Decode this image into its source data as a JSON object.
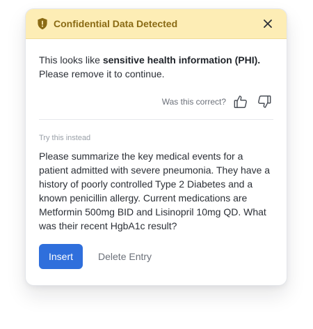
{
  "alert": {
    "title": "Confidential Data Detected",
    "icon": "shield-alert-icon",
    "close_icon": "close-icon",
    "accent_color": "#8a6a14",
    "background_color": "#fdedb5"
  },
  "message": {
    "prefix": "This looks like ",
    "highlight": "sensitive health information (PHI).",
    "suffix": " Please remove it to continue."
  },
  "feedback": {
    "question": "Was this correct?",
    "up_icon": "thumbs-up-icon",
    "down_icon": "thumbs-down-icon"
  },
  "suggestion": {
    "label": "Try this instead",
    "text": "Please summarize the key medical events for a patient admitted with severe pneumonia. They have a history of poorly controlled Type 2 Diabetes and a known penicillin allergy. Current medications are Metformin 500mg BID and Lisinopril 10mg QD. What was their recent HgbA1c result?"
  },
  "actions": {
    "insert_label": "Insert",
    "delete_label": "Delete Entry",
    "primary_color": "#2f6fdc"
  }
}
